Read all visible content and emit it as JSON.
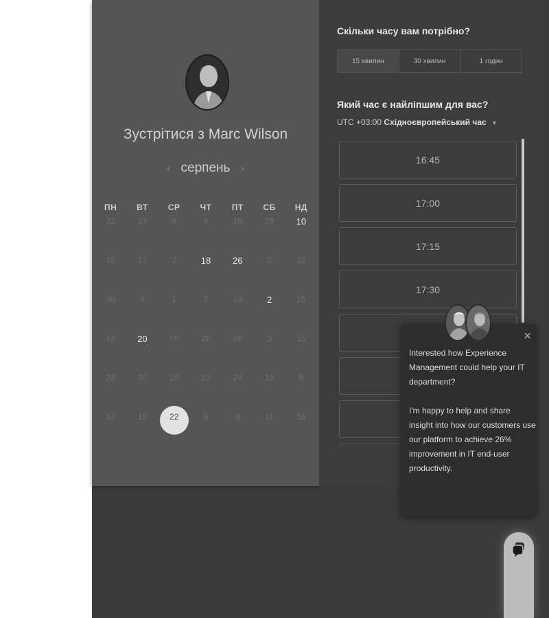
{
  "host": {
    "title": "Зустрітися з Marc Wilson"
  },
  "calendar": {
    "month": "серпень",
    "prev_icon": "chevron-left-icon",
    "next_icon": "chevron-right-icon",
    "weekdays": [
      "ПН",
      "ВТ",
      "СР",
      "ЧТ",
      "ПТ",
      "СБ",
      "НД"
    ],
    "weeks": [
      [
        {
          "d": "22",
          "s": "dim"
        },
        {
          "d": "23",
          "s": "dim"
        },
        {
          "d": "6",
          "s": "dim"
        },
        {
          "d": "8",
          "s": "dim"
        },
        {
          "d": "18",
          "s": "dim"
        },
        {
          "d": "29",
          "s": "dim"
        },
        {
          "d": "10",
          "s": "avail"
        }
      ],
      [
        {
          "d": "15",
          "s": "dim"
        },
        {
          "d": "17",
          "s": "dim"
        },
        {
          "d": "2",
          "s": "dim"
        },
        {
          "d": "18",
          "s": "avail"
        },
        {
          "d": "26",
          "s": "avail"
        },
        {
          "d": "3",
          "s": "dim"
        },
        {
          "d": "12",
          "s": "dim"
        }
      ],
      [
        {
          "d": "30",
          "s": "dim"
        },
        {
          "d": "4",
          "s": "dim"
        },
        {
          "d": "1",
          "s": "dim"
        },
        {
          "d": "7",
          "s": "dim"
        },
        {
          "d": "13",
          "s": "dim"
        },
        {
          "d": "2",
          "s": "avail"
        },
        {
          "d": "15",
          "s": "dim"
        }
      ],
      [
        {
          "d": "13",
          "s": "dim"
        },
        {
          "d": "20",
          "s": "avail"
        },
        {
          "d": "10",
          "s": "dim"
        },
        {
          "d": "20",
          "s": "dim"
        },
        {
          "d": "16",
          "s": "dim"
        },
        {
          "d": "3",
          "s": "dim"
        },
        {
          "d": "15",
          "s": "dim"
        }
      ],
      [
        {
          "d": "28",
          "s": "dim"
        },
        {
          "d": "30",
          "s": "dim"
        },
        {
          "d": "10",
          "s": "dim"
        },
        {
          "d": "13",
          "s": "dim"
        },
        {
          "d": "24",
          "s": "dim"
        },
        {
          "d": "19",
          "s": "dim"
        },
        {
          "d": "8",
          "s": "dim"
        }
      ],
      [
        {
          "d": "13",
          "s": "dim"
        },
        {
          "d": "19",
          "s": "dim"
        },
        {
          "d": "22",
          "s": "sel"
        },
        {
          "d": "5",
          "s": "dim"
        },
        {
          "d": "9",
          "s": "dim"
        },
        {
          "d": "11",
          "s": "dim"
        },
        {
          "d": "16",
          "s": "dim"
        }
      ]
    ]
  },
  "duration": {
    "question": "Скільки часу вам потрібно?",
    "options": [
      "15 хвилин",
      "30 хвилин",
      "1 годин"
    ],
    "selected_index": 0
  },
  "time": {
    "question": "Який час є найліпшим для вас?",
    "tz_offset": "UTC +03:00",
    "tz_name": "Східноєвропейський час",
    "slots": [
      "16:45",
      "17:00",
      "17:15",
      "17:30",
      "",
      "",
      "",
      ""
    ]
  },
  "popup": {
    "message_1": "Interested how Experience Management could help your IT department?",
    "message_2": "I'm happy to help and share insight into how our customers use our platform to achieve 26% improvement in IT end-user productivity.",
    "close_label": "×"
  },
  "colors": {
    "left_panel": "#555555",
    "right_panel": "#3c3c3c",
    "backdrop": "#3b3b3b",
    "popup": "#2d2d2d",
    "selected_day": "#e2e2e2"
  }
}
